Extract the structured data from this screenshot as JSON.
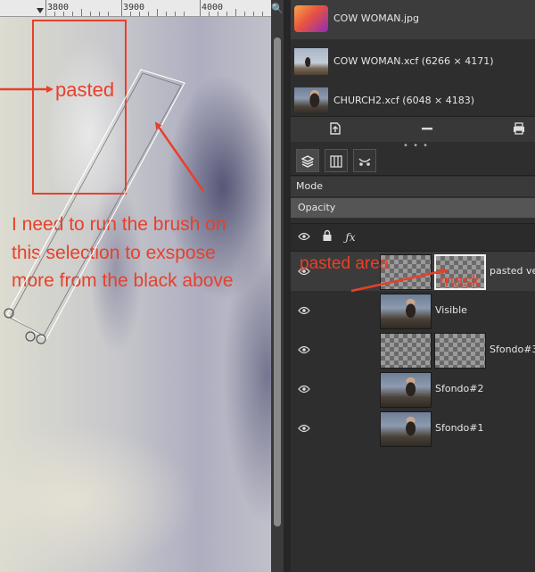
{
  "canvas": {
    "ruler": {
      "labels": [
        "3800",
        "3900",
        "4000"
      ]
    },
    "annotations": {
      "pasted": "pasted",
      "instruction_lines": [
        "I need to run the brush on",
        "this selection to exspose",
        "more from the black above"
      ]
    }
  },
  "images": [
    {
      "name": "COW WOMAN.jpg"
    },
    {
      "name": "COW WOMAN.xcf (6266 × 4171)"
    },
    {
      "name": "CHURCH2.xcf (6048 × 4183)"
    }
  ],
  "layers_panel": {
    "mode_label": "Mode",
    "opacity_label": "Opacity",
    "layers": [
      {
        "name": "pasted vert",
        "has_mask": true,
        "selected": true
      },
      {
        "name": "Visible",
        "has_mask": false
      },
      {
        "name": "Sfondo#3",
        "has_mask": true
      },
      {
        "name": "Sfondo#2",
        "has_mask": false
      },
      {
        "name": "Sfondo#1",
        "has_mask": false
      }
    ],
    "annotations": {
      "pasted_area": "pasted area",
      "mask": "mask"
    }
  },
  "colors": {
    "annotation": "#e8402a",
    "panel_bg": "#2e2e2e",
    "selected_row": "#3b3b3b"
  },
  "icons": {
    "search": "search-icon",
    "eye": "eye-icon",
    "lock": "lock-icon",
    "fx": "fx-icon"
  }
}
